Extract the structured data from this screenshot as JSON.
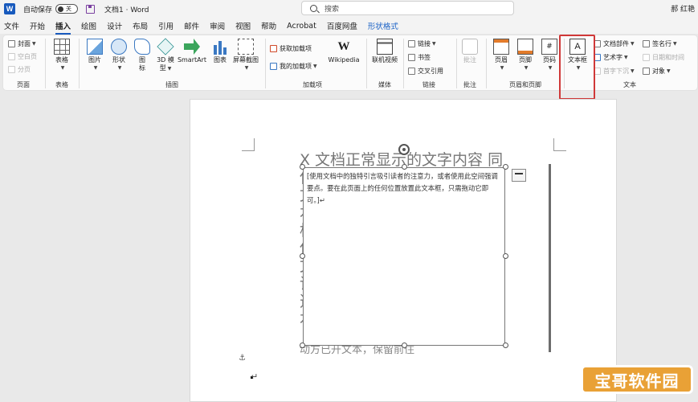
{
  "titlebar": {
    "app_logo": "W",
    "autosave_label": "自动保存",
    "autosave_state": "关",
    "doc_title": "文档1 · Word",
    "search_placeholder": "搜索",
    "user_name": "郝 红艳"
  },
  "menu_tabs": [
    {
      "label": "文件"
    },
    {
      "label": "开始"
    },
    {
      "label": "插入",
      "active": true
    },
    {
      "label": "绘图"
    },
    {
      "label": "设计"
    },
    {
      "label": "布局"
    },
    {
      "label": "引用"
    },
    {
      "label": "邮件"
    },
    {
      "label": "审阅"
    },
    {
      "label": "视图"
    },
    {
      "label": "帮助"
    },
    {
      "label": "Acrobat"
    },
    {
      "label": "百度网盘"
    },
    {
      "label": "形状格式",
      "special": true
    }
  ],
  "ribbon": {
    "pages": {
      "cover": "封面",
      "blank": "空白页",
      "break": "分页",
      "group": "页面"
    },
    "tables": {
      "table": "表格",
      "group": "表格"
    },
    "illustrations": {
      "pictures": "图片",
      "shapes": "形状",
      "icons_l1": "图",
      "icons_l2": "标",
      "model3d_l1": "3D 模",
      "model3d_l2": "型",
      "smartart": "SmartArt",
      "chart": "图表",
      "screenshot": "屏幕截图",
      "group": "插图"
    },
    "addins": {
      "get": "获取加载项",
      "my": "我的加载项",
      "wikipedia": "Wikipedia",
      "group": "加载项"
    },
    "media": {
      "video": "联机视频",
      "group": "媒体"
    },
    "links": {
      "link": "链接",
      "bookmark": "书签",
      "crossref": "交叉引用",
      "group": "链接"
    },
    "comments": {
      "comment": "批注",
      "group": "批注"
    },
    "header_footer": {
      "header": "页眉",
      "footer": "页脚",
      "page_number": "页码",
      "group": "页眉和页脚"
    },
    "text": {
      "textbox": "文本框",
      "quickparts": "文档部件",
      "wordart": "艺术字",
      "dropcap": "首字下沉",
      "signature": "签名行",
      "datetime": "日期和时间",
      "object": "对象",
      "group": "文本",
      "wiki_glyph": "W",
      "textbox_glyph": "A",
      "page_number_glyph": "#"
    }
  },
  "document": {
    "textbox_text": "[使用文档中的独特引言吸引读者的注意力，或者使用此空间强调要点。要在此页面上的任何位置放置此文本框，只需拖动它即可。]↵",
    "bg_text_lines": [
      "X 文档正常显示的文字内容 同",
      "使",
      "文",
      "本",
      "框",
      "使",
      "文",
      "请",
      "选",
      "本"
    ],
    "clipped_text": "动方已开文本，保留前住",
    "anchor_glyph": "⚓",
    "para_mark": "↵"
  },
  "watermark": "宝哥软件园"
}
